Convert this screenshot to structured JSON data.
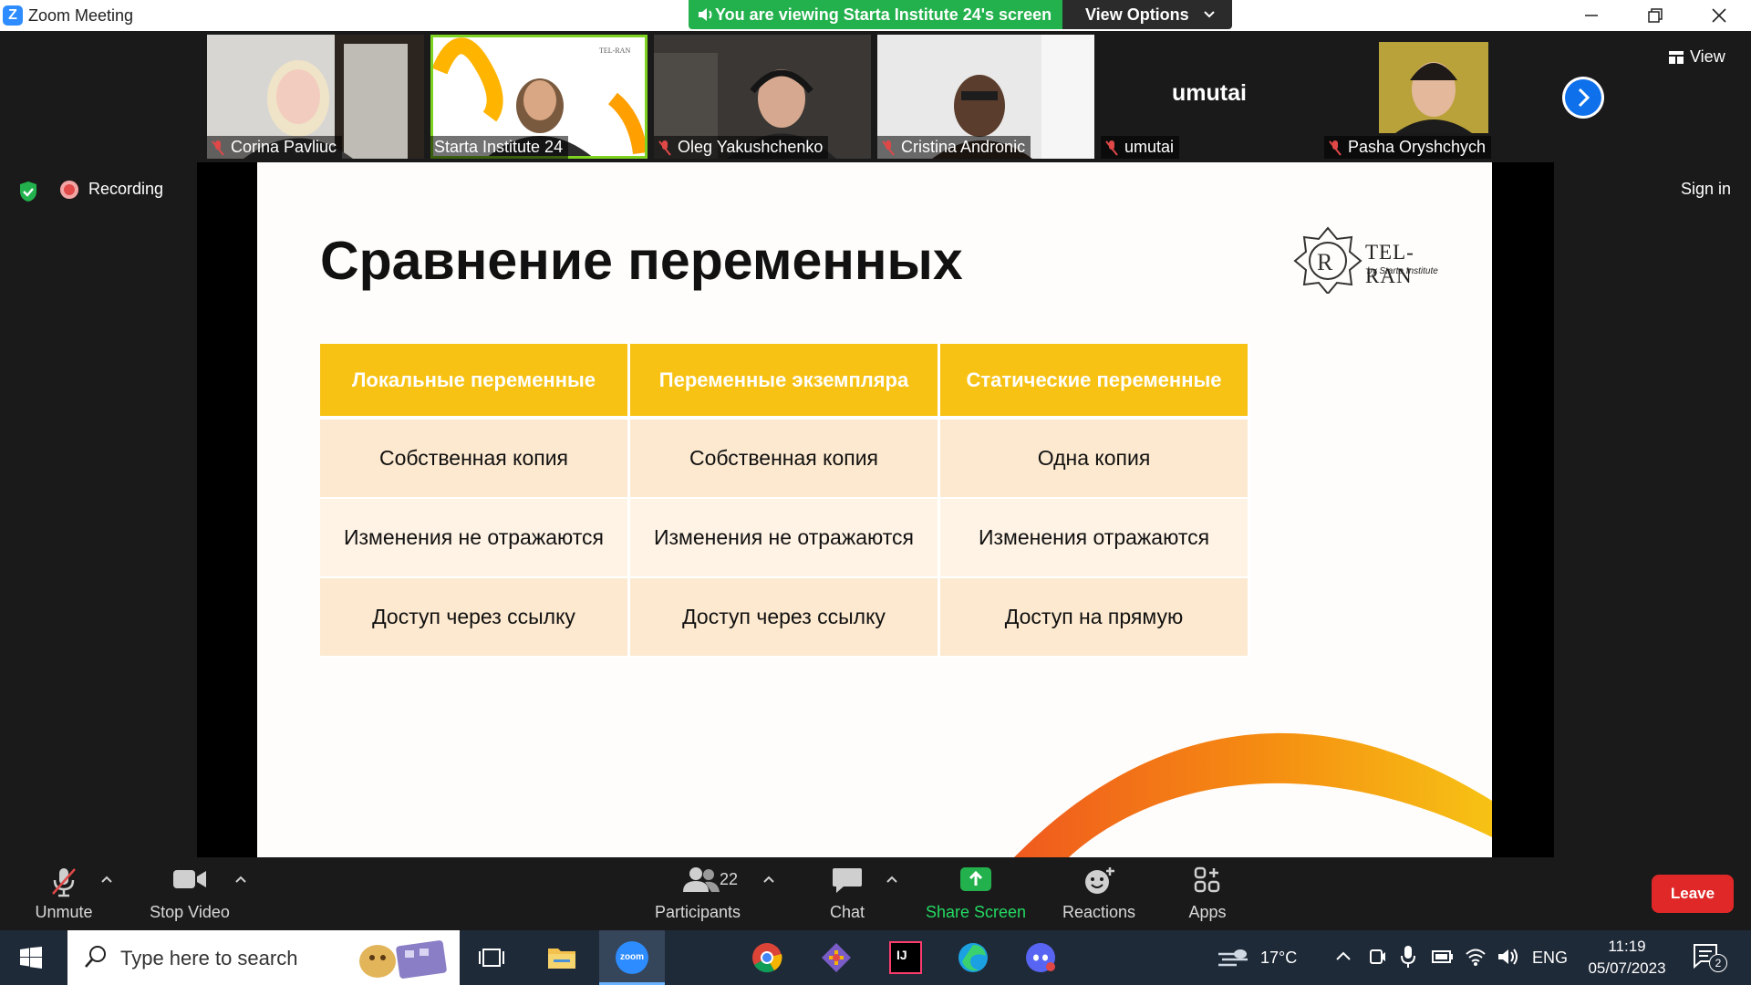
{
  "titlebar": {
    "app_title": "Zoom Meeting",
    "share_banner": "You are viewing Starta Institute 24's screen",
    "view_options": "View Options"
  },
  "gallery": {
    "participants": [
      {
        "name": "Corina Pavliuc",
        "muted": true
      },
      {
        "name": "Starta Institute 24",
        "muted": false,
        "active": true
      },
      {
        "name": "Oleg Yakushchenko",
        "muted": true
      },
      {
        "name": "Cristina Andronic",
        "muted": true
      },
      {
        "name": "umutai",
        "muted": true,
        "big_name": "umutai"
      },
      {
        "name": "Pasha Oryshchych",
        "muted": true
      }
    ],
    "view_label": "View"
  },
  "status": {
    "recording_label": "Recording",
    "sign_in": "Sign in"
  },
  "slide": {
    "title": "Сравнение переменных",
    "logo_text": "TEL-RAN",
    "logo_sub": "by Starta Institute",
    "logo_mini": "TEL-RAN",
    "table": {
      "headers": [
        "Локальные переменные",
        "Переменные экземпляра",
        "Статические переменные"
      ],
      "rows": [
        [
          "Собственная копия",
          "Собственная копия",
          "Одна копия"
        ],
        [
          "Изменения не отражаются",
          "Изменения не отражаются",
          "Изменения отражаются"
        ],
        [
          "Доступ через ссылку",
          "Доступ через ссылку",
          "Доступ на прямую"
        ]
      ]
    },
    "accent_yellow": "#f7c214",
    "accent_orange": "#f07a1e"
  },
  "toolbar": {
    "unmute": "Unmute",
    "stop_video": "Stop Video",
    "participants": "Participants",
    "participants_count": "22",
    "chat": "Chat",
    "share_screen": "Share Screen",
    "reactions": "Reactions",
    "apps": "Apps",
    "leave": "Leave"
  },
  "taskbar": {
    "search_placeholder": "Type here to search",
    "zoom_label": "zoom",
    "intellij_label": "IJ",
    "weather": "17°C",
    "language": "ENG",
    "time": "11:19",
    "date": "05/07/2023",
    "notifications": "2"
  }
}
